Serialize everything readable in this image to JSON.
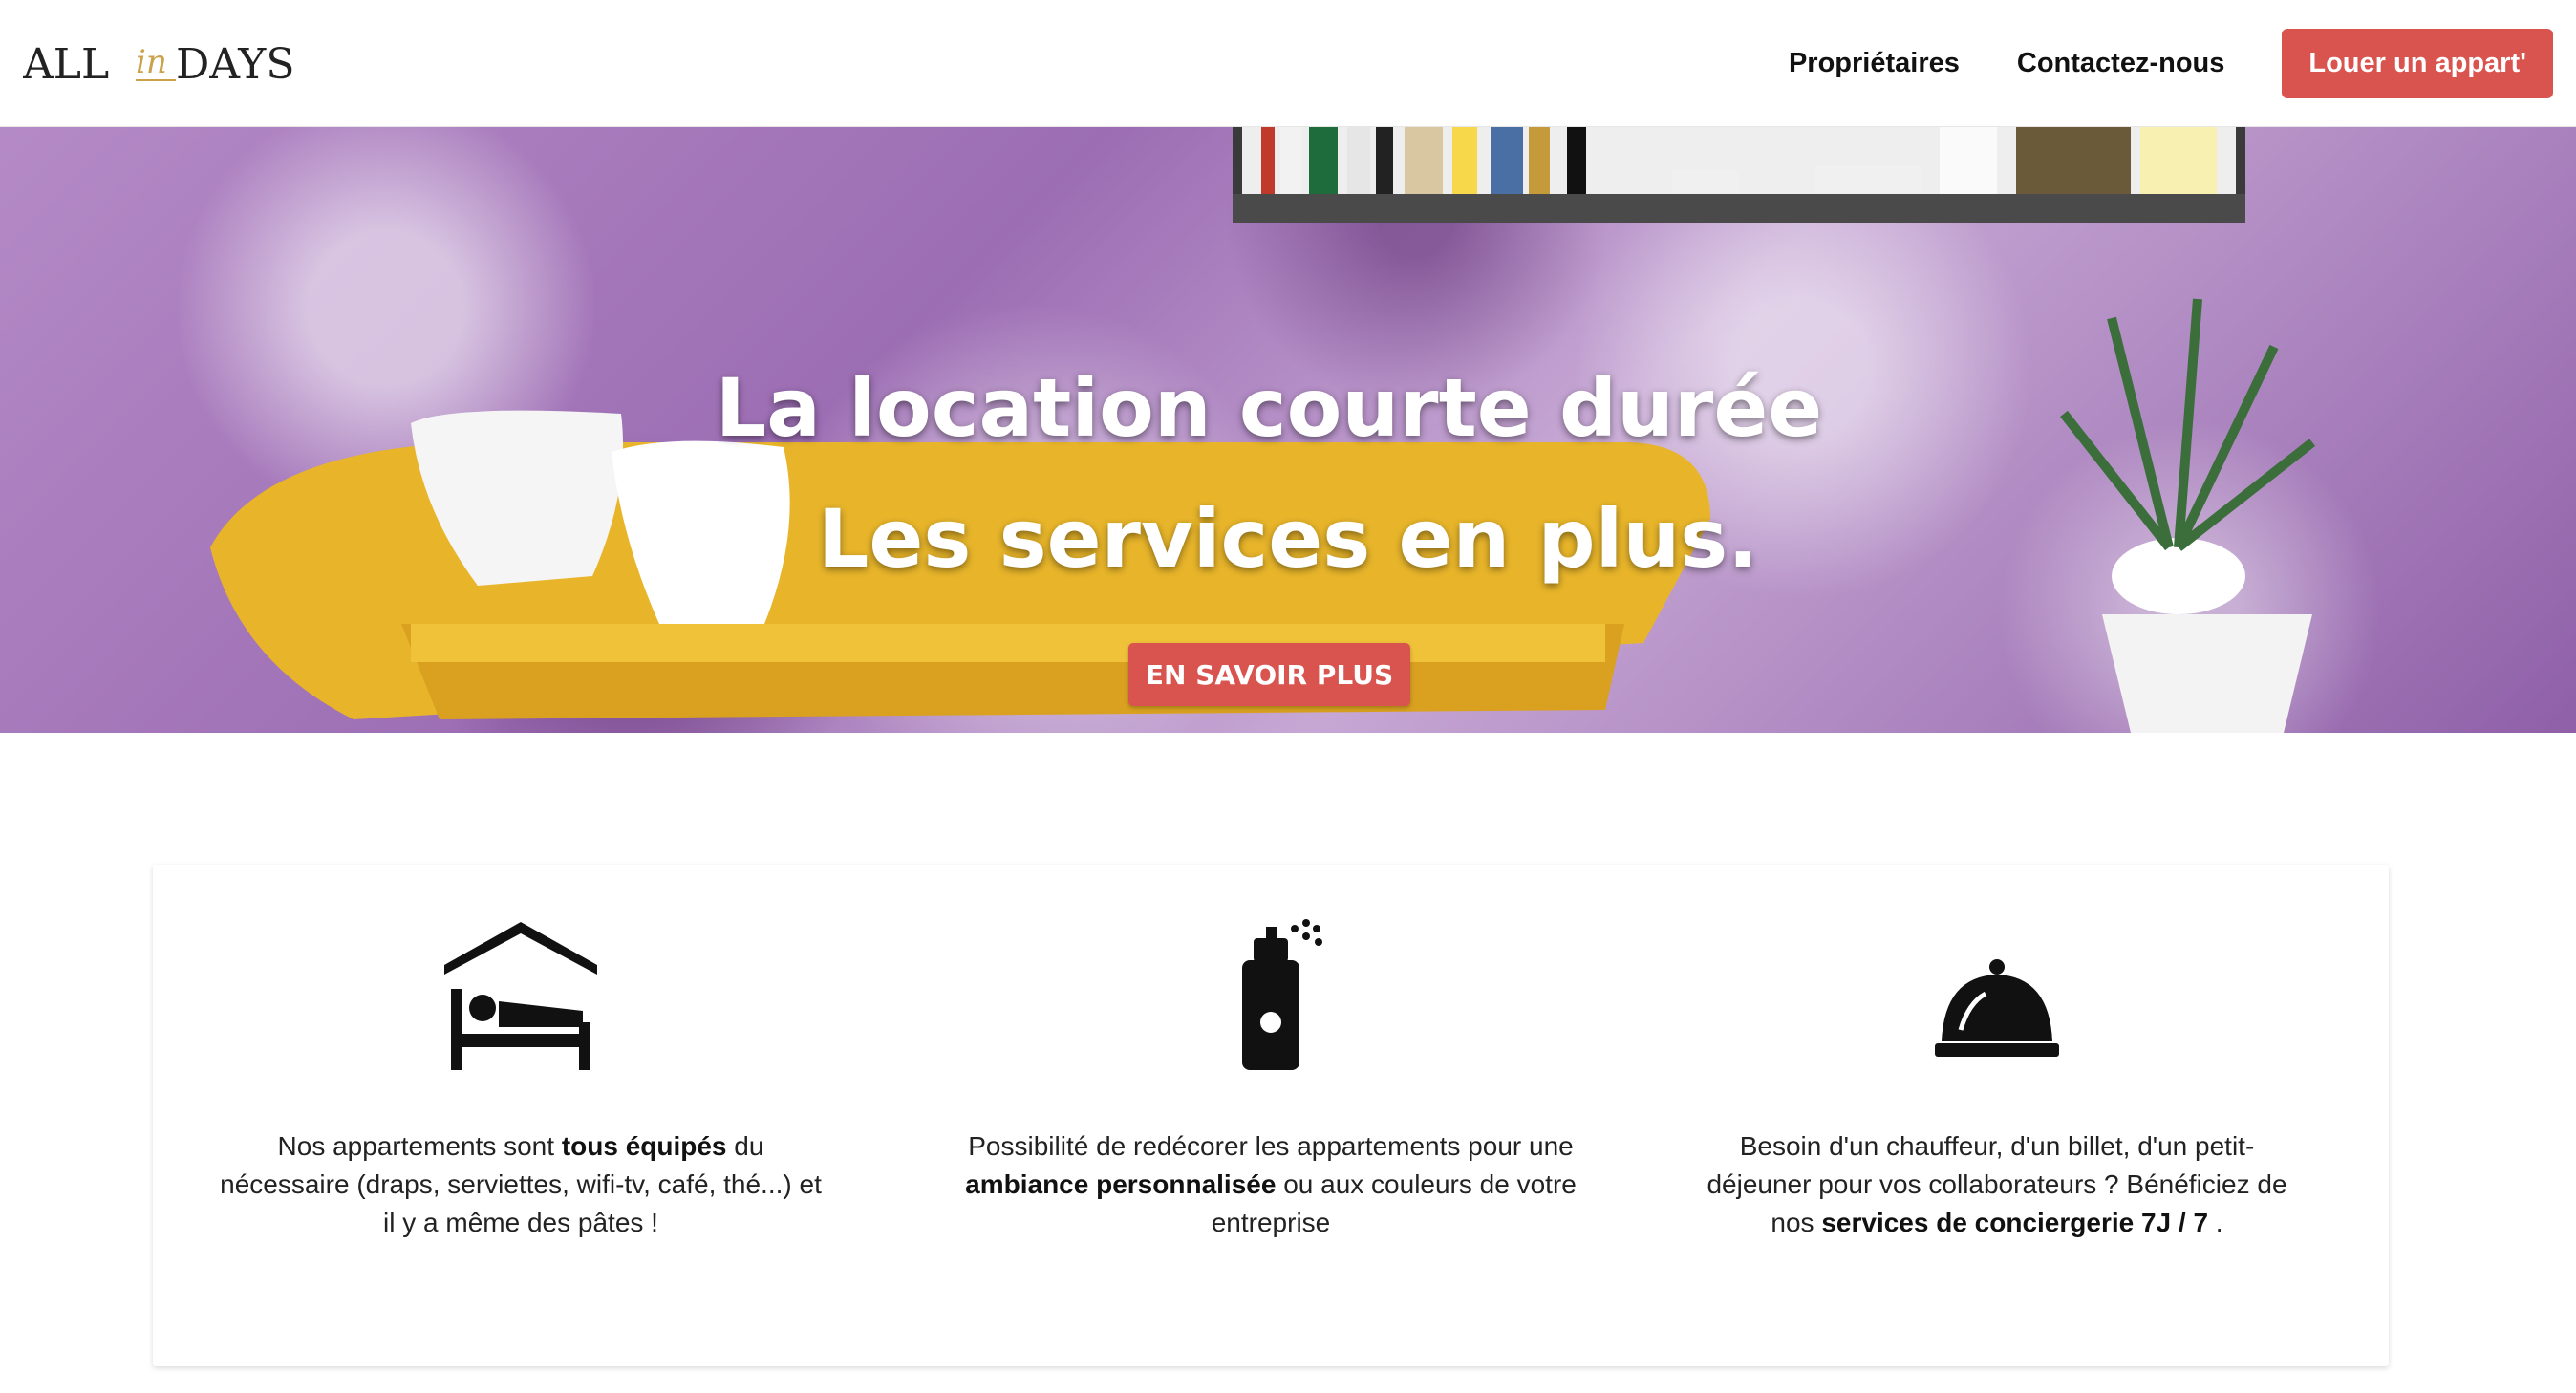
{
  "nav": {
    "logo": {
      "left": "ALL",
      "middle": "in",
      "right": "DAYS"
    },
    "links": [
      "Propriétaires",
      "Contactez-nous"
    ],
    "cta": "Louer un appart'"
  },
  "hero": {
    "line1": "La location courte durée",
    "line2": "Les services en plus.",
    "button": "EN SAVOIR PLUS"
  },
  "features": [
    {
      "icon": "hotel-bed-icon",
      "t1": "Nos appartements sont ",
      "b1": "tous équipés",
      "t2": " du nécessaire (draps, serviettes, wifi-tv, café, thé...) et il y a même des pâtes !",
      "b2": "",
      "t3": ""
    },
    {
      "icon": "spray-can-icon",
      "t1": "Possibilité de redécorer les appartements pour une ",
      "b1": "ambiance personnalisée",
      "t2": " ou aux couleurs de votre entreprise",
      "b2": "",
      "t3": ""
    },
    {
      "icon": "service-bell-icon",
      "t1": "Besoin d'un chauffeur, d'un billet, d'un petit-déjeuner pour vos collaborateurs ? Bénéficiez de nos ",
      "b1": "services de conciergerie 7J / 7",
      "t2": " .",
      "b2": "",
      "t3": ""
    }
  ],
  "colors": {
    "accent": "#d9534f",
    "hero_purple": "#9c6db3",
    "sofa": "#e8b52a"
  }
}
